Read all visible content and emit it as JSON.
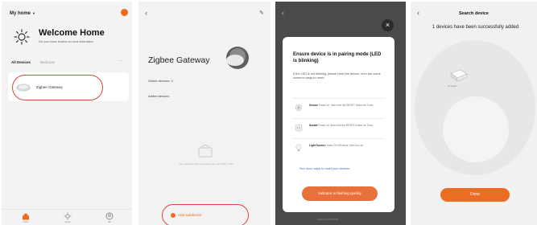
{
  "screen1": {
    "home_title": "My home",
    "welcome": "Welcome Home",
    "welcome_sub": "Set your home location for more information",
    "tabs": [
      "All Devices",
      "Bedroom"
    ],
    "more": "···",
    "device_name": "Zigbee Gateway",
    "nav": [
      "Home",
      "Scene",
      "Me"
    ],
    "accent": "#f06a1b"
  },
  "screen2": {
    "title": "Zigbee Gateway",
    "online_devices": "Online devices: 0",
    "added_devices": "Added devices",
    "empty_text": "Your Gateway has no devices yet, tap \"Add\" to add",
    "add_button": "Add subdevice"
  },
  "screen3": {
    "close": "×",
    "title": "Ensure device is in pairing mode (LED is blinking)",
    "desc": "If the LED is not blinking, please reset the device, here are some common ways to reset:",
    "rows": [
      {
        "name": "Sensor",
        "text": "Power on, then hold the RESET button for 5 sec"
      },
      {
        "name": "Socket",
        "text": "Power on, then hold the RESET button for 5 sec"
      },
      {
        "name": "Light Source",
        "text": "Power On-Off thrice, then turn on"
      }
    ],
    "more_ways": "See more ways to reset your devices",
    "confirm_button": "Indicator is flashing quickly",
    "behind_text": "Add subdevice"
  },
  "screen4": {
    "title": "Search device",
    "message": "1 devices have been successfully added",
    "found_label": "1/1 added",
    "done_button": "Done"
  }
}
